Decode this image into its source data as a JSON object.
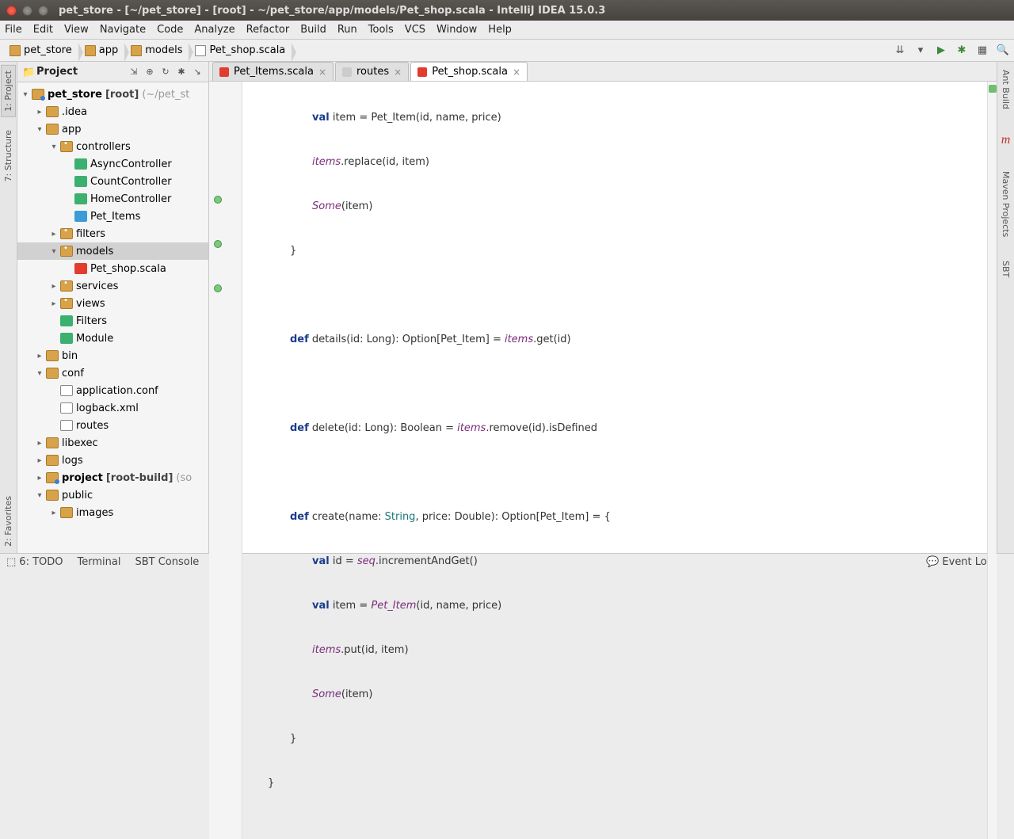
{
  "title": "pet_store - [~/pet_store] - [root] - ~/pet_store/app/models/Pet_shop.scala - IntelliJ IDEA 15.0.3",
  "menu": [
    "File",
    "Edit",
    "View",
    "Navigate",
    "Code",
    "Analyze",
    "Refactor",
    "Build",
    "Run",
    "Tools",
    "VCS",
    "Window",
    "Help"
  ],
  "crumbs": [
    {
      "icon": "folder",
      "label": "pet_store"
    },
    {
      "icon": "folder",
      "label": "app"
    },
    {
      "icon": "folder",
      "label": "models"
    },
    {
      "icon": "file",
      "label": "Pet_shop.scala"
    }
  ],
  "left_tabs": [
    "1: Project",
    "7: Structure",
    "2: Favorites"
  ],
  "projectpane": {
    "title": "Project"
  },
  "tree": {
    "root": "pet_store",
    "root_tag": "[root]",
    "root_path": "(~/pet_st",
    "idea": ".idea",
    "app": "app",
    "controllers": "controllers",
    "ctr": [
      "AsyncController",
      "CountController",
      "HomeController",
      "Pet_Items"
    ],
    "filters": "filters",
    "models": "models",
    "pet_shop": "Pet_shop.scala",
    "services": "services",
    "views": "views",
    "filters2": "Filters",
    "module": "Module",
    "bin": "bin",
    "conf": "conf",
    "appconf": "application.conf",
    "logback": "logback.xml",
    "routes": "routes",
    "libexec": "libexec",
    "logs": "logs",
    "project": "project",
    "project_tag": "[root-build]",
    "project_path": "(so",
    "public": "public",
    "images": "images"
  },
  "tabs": [
    {
      "label": "Pet_Items.scala",
      "icon": "#e23c2e",
      "active": false
    },
    {
      "label": "routes",
      "icon": "#888",
      "active": false
    },
    {
      "label": "Pet_shop.scala",
      "icon": "#e23c2e",
      "active": true
    }
  ],
  "code": {
    "l1a": "val",
    "l1b": " item = Pet_Item(id, name, price)",
    "l2a": "items",
    "l2b": ".replace(id, item)",
    "l3a": "Some",
    "l3b": "(item)",
    "l4": "}",
    "l6a": "def",
    "l6b": " details(id: Long): Option[Pet_Item] = ",
    "l6c": "items",
    "l6d": ".get(id)",
    "l8a": "def",
    "l8b": " delete(id: Long): Boolean = ",
    "l8c": "items",
    "l8d": ".remove(id).isDefined",
    "l10a": "def",
    "l10b": " create(name: ",
    "l10c": "String",
    "l10d": ", price: Double): Option[Pet_Item] = {",
    "l11a": "val",
    "l11b": " id = ",
    "l11c": "seq",
    "l11d": ".incrementAndGet()",
    "l12a": "val",
    "l12b": " item = ",
    "l12c": "Pet_Item",
    "l12d": "(id, name, price)",
    "l13a": "items",
    "l13b": ".put(id, item)",
    "l14a": "Some",
    "l14b": "(item)",
    "l15": "}",
    "l16": "}"
  },
  "right_tabs": [
    "Ant Build",
    "m",
    "Maven Projects",
    "SBT"
  ],
  "bottom": [
    "6: TODO",
    "Terminal",
    "SBT Console"
  ],
  "status_right": "Event Log"
}
